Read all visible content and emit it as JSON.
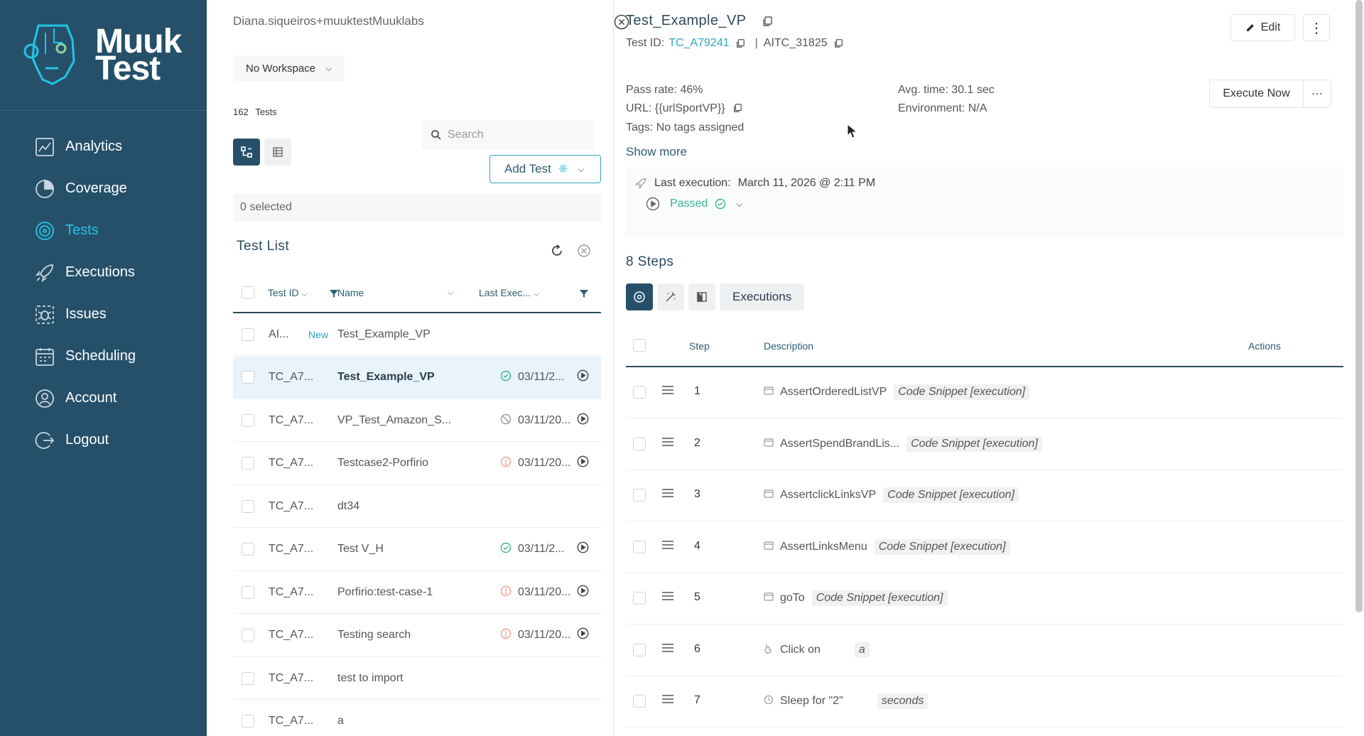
{
  "brand": {
    "line1": "Muuk",
    "line2": "Test"
  },
  "colors": {
    "sidebar": "#26506a",
    "accent": "#23c4e6",
    "link": "#2fa6b9",
    "passed": "#3bb48e",
    "warning": "#f2a38a"
  },
  "nav": [
    {
      "label": "Analytics",
      "icon": "analytics-icon"
    },
    {
      "label": "Coverage",
      "icon": "coverage-icon"
    },
    {
      "label": "Tests",
      "icon": "tests-icon",
      "active": true
    },
    {
      "label": "Executions",
      "icon": "rocket-icon"
    },
    {
      "label": "Issues",
      "icon": "bug-icon"
    },
    {
      "label": "Scheduling",
      "icon": "calendar-icon"
    },
    {
      "label": "Account",
      "icon": "user-icon"
    },
    {
      "label": "Logout",
      "icon": "logout-icon"
    }
  ],
  "middle": {
    "user": "Diana.siqueiros+muuktestMuuklabs",
    "workspace": "No Workspace",
    "count": "162",
    "count_label": "Tests",
    "search_placeholder": "Search",
    "add_test": "Add Test",
    "selected": "0 selected",
    "list_title": "Test List",
    "columns": {
      "test_id": "Test ID",
      "name": "Name",
      "last_exec": "Last Exec..."
    },
    "rows": [
      {
        "id": "AI...",
        "badge": "New",
        "name": "Test_Example_VP",
        "status": "",
        "date": ""
      },
      {
        "id": "TC_A7...",
        "badge": "",
        "name": "Test_Example_VP",
        "status": "passed",
        "date": "03/11/2...",
        "selected": true
      },
      {
        "id": "TC_A7...",
        "badge": "",
        "name": "VP_Test_Amazon_S...",
        "status": "skipped",
        "date": "03/11/20..."
      },
      {
        "id": "TC_A7...",
        "badge": "",
        "name": "Testcase2-Porfirio",
        "status": "failed",
        "date": "03/11/20..."
      },
      {
        "id": "TC_A7...",
        "badge": "",
        "name": "dt34",
        "status": "",
        "date": ""
      },
      {
        "id": "TC_A7...",
        "badge": "",
        "name": "Test V_H",
        "status": "passed",
        "date": "03/11/2..."
      },
      {
        "id": "TC_A7...",
        "badge": "",
        "name": "Porfirio:test-case-1",
        "status": "failed",
        "date": "03/11/20..."
      },
      {
        "id": "TC_A7...",
        "badge": "",
        "name": "Testing search",
        "status": "failed",
        "date": "03/11/20..."
      },
      {
        "id": "TC_A7...",
        "badge": "",
        "name": "test to import",
        "status": "",
        "date": ""
      },
      {
        "id": "TC_A7...",
        "badge": "",
        "name": "a",
        "status": "",
        "date": ""
      }
    ]
  },
  "detail": {
    "title": "Test_Example_VP",
    "test_id_label": "Test ID:",
    "test_id": "TC_A79241",
    "aitc": "AITC_31825",
    "edit": "Edit",
    "pass_rate": "Pass rate: 46%",
    "url": "URL: {{urlSportVP}}",
    "tags": "Tags: No tags assigned",
    "avg_time": "Avg. time: 30.1 sec",
    "environment": "Environment: N/A",
    "execute_now": "Execute Now",
    "show_more": "Show more",
    "last_execution_label": "Last execution:",
    "last_execution_value": "March 11, 2026 @ 2:11 PM",
    "status": "Passed",
    "steps_title": "8 Steps",
    "executions_tab": "Executions",
    "columns": {
      "step": "Step",
      "description": "Description",
      "actions": "Actions"
    },
    "steps": [
      {
        "num": "1",
        "text": "AssertOrderedListVP",
        "chip": "Code Snippet [execution]",
        "icon": "code-icon"
      },
      {
        "num": "2",
        "text": "AssertSpendBrandLis...",
        "chip": "Code Snippet [execution]",
        "icon": "code-icon"
      },
      {
        "num": "3",
        "text": "AssertclickLinksVP",
        "chip": "Code Snippet [execution]",
        "icon": "code-icon"
      },
      {
        "num": "4",
        "text": "AssertLinksMenu",
        "chip": "Code Snippet [execution]",
        "icon": "code-icon"
      },
      {
        "num": "5",
        "text": "goTo",
        "chip": "Code Snippet [execution]",
        "icon": "code-icon"
      },
      {
        "num": "6",
        "text": "Click on",
        "chip": "a",
        "icon": "click-icon"
      },
      {
        "num": "7",
        "text": "Sleep for  \"2\"",
        "chip": "seconds",
        "icon": "clock-icon"
      }
    ]
  }
}
